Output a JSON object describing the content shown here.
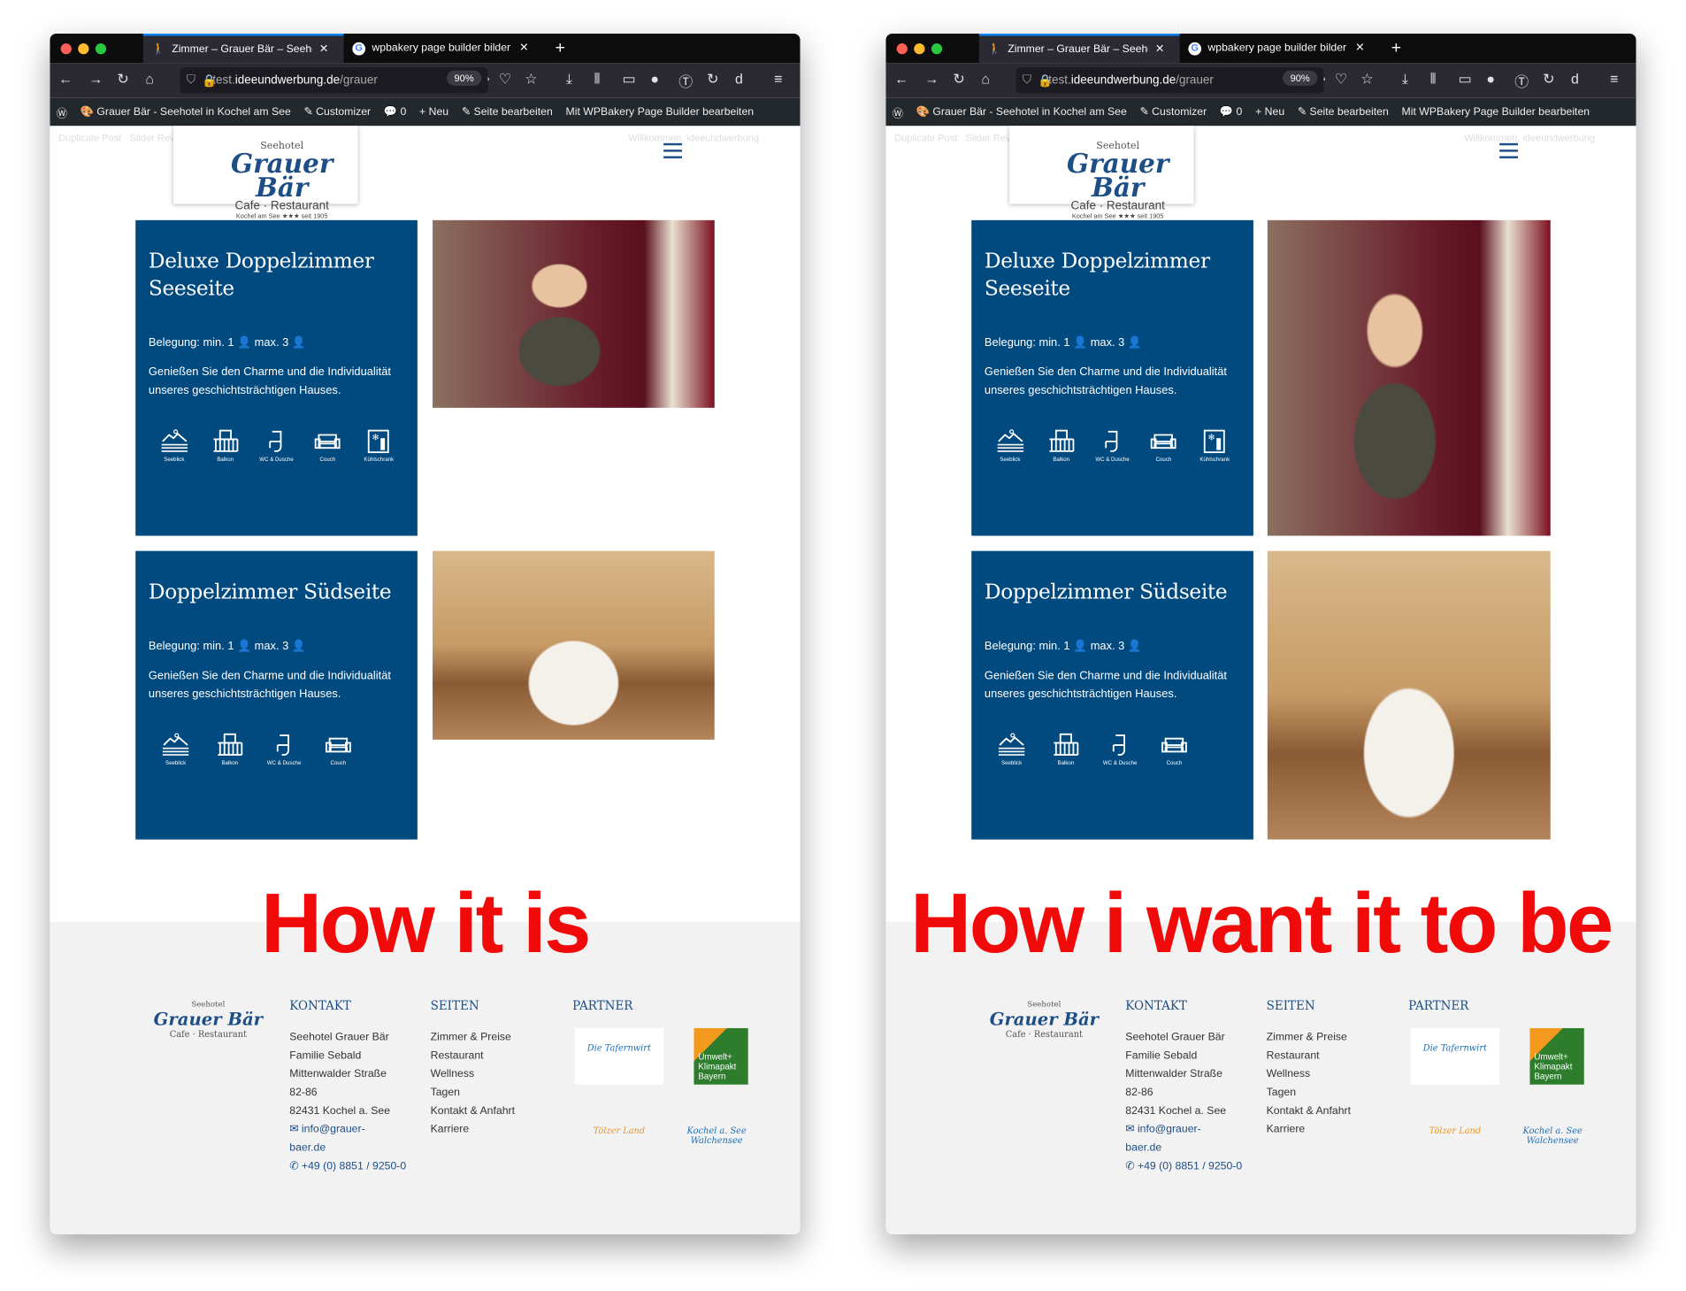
{
  "browser": {
    "tabs": [
      {
        "title": "Zimmer – Grauer Bär – Seehotel",
        "active": true
      },
      {
        "title": "wpbakery page builder bilder responsive",
        "active": false
      }
    ],
    "new_tab": "+",
    "url_prefix": "test.",
    "url_domain": "ideeundwerbung.de",
    "url_path": "/grauer",
    "zoom": "90%"
  },
  "admin_bar": {
    "site": "Grauer Bär - Seehotel in Kochel am See",
    "customizer": "Customizer",
    "comments": "0",
    "new": "Neu",
    "edit": "Seite bearbeiten",
    "wpbakery": "Mit WPBakery Page Builder bearbeiten"
  },
  "subbar": {
    "duplicate": "Duplicate Post",
    "slider": "Slider Revolution",
    "welcome": "Willkommen, ideeundwerbung"
  },
  "logo": {
    "line1": "Seehotel",
    "line2": "Grauer Bär",
    "line3": "Cafe · Restaurant",
    "line4": "Kochel am See ★★★ seit 1905"
  },
  "cards": [
    {
      "title": "Deluxe Doppelzimmer Seeseite",
      "occupancy": "Belegung: min. 1 👤 max. 3 👤",
      "description": "Genießen Sie den Charme und die Individualität unseres geschichtsträchtigen Hauses.",
      "amenities": [
        "Seeblick",
        "Balkon",
        "WC & Dusche",
        "Couch",
        "Kühlschrank"
      ]
    },
    {
      "title": "Doppelzimmer Südseite",
      "occupancy": "Belegung: min. 1 👤 max. 3 👤",
      "description": "Genießen Sie den Charme und die Individualität unseres geschichtsträchtigen Hauses.",
      "amenities": [
        "Seeblick",
        "Balkon",
        "WC & Dusche",
        "Couch"
      ]
    }
  ],
  "windows": [
    {
      "caption": "How it is",
      "image_fit": "partial"
    },
    {
      "caption": "How i want it  to be",
      "image_fit": "full"
    }
  ],
  "footer": {
    "kontakt": {
      "heading": "KONTAKT",
      "lines": [
        "Seehotel Grauer Bär",
        "Familie Sebald",
        "Mittenwalder Straße",
        "82-86",
        "82431 Kochel a. See"
      ],
      "email": "✉ info@grauer-baer.de",
      "phone": "✆ +49 (0) 8851 / 9250-0"
    },
    "seiten": {
      "heading": "SEITEN",
      "links": [
        "Zimmer & Preise",
        "Restaurant",
        "Wellness",
        "Tagen",
        "Kontakt & Anfahrt",
        "Karriere"
      ]
    },
    "partner": {
      "heading": "PARTNER",
      "logos": [
        "Die Tafernwirt",
        "Umwelt+ Klimapakt Bayern",
        "Tölzer Land",
        "Kochel a. See Walchensee"
      ]
    }
  },
  "colors": {
    "card": "#004a7f",
    "brand": "#1d4e86",
    "caption": "#f00a0a",
    "footer_bg": "#f2f2f2"
  }
}
